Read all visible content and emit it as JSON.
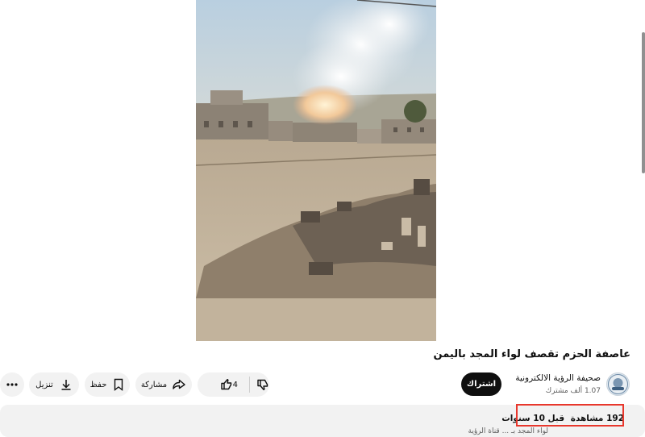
{
  "video": {
    "title": "عاصفة الحزم تقصف لواء المجد باليمن"
  },
  "channel": {
    "name": "صحيفة الرؤية الالكترونية",
    "subscribers": "1.07 ألف مشترك",
    "subscribe_label": "اشتراك"
  },
  "actions": {
    "likes_count": "4",
    "share_label": "مشاركة",
    "save_label": "حفظ",
    "download_label": "تنزيل"
  },
  "description": {
    "views": "192 مشاهدة",
    "date": "قبل 10 سنوات",
    "snippet": "لواء المجد بـ ... قناة الرؤية"
  },
  "colors": {
    "highlight": "#e8372c",
    "subscribe_bg": "#0f0f0f",
    "pill_bg": "#f2f2f2"
  }
}
